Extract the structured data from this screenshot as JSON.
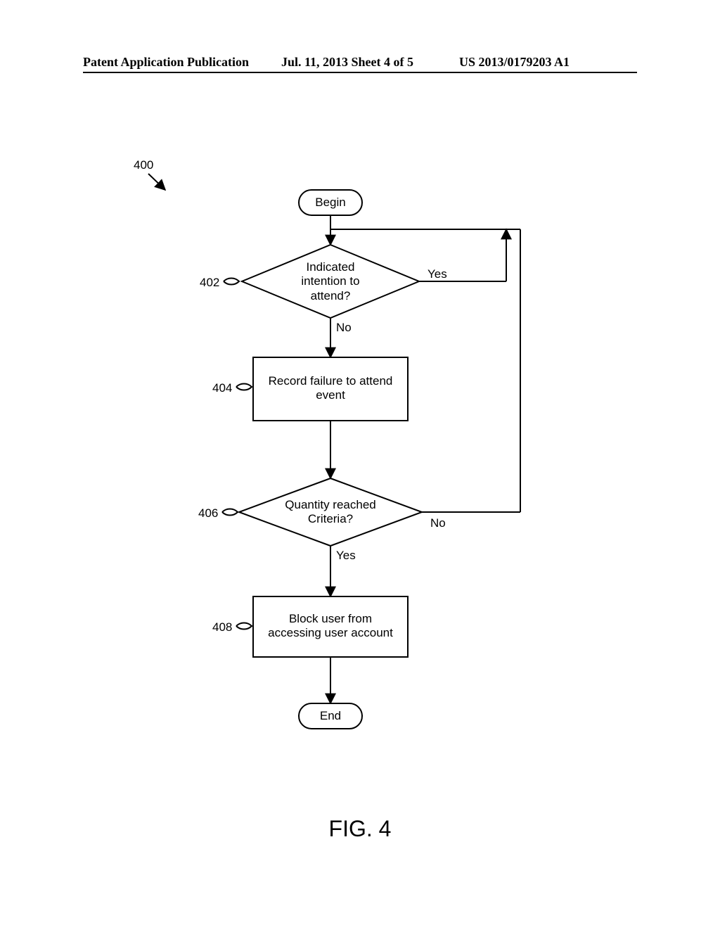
{
  "header": {
    "left": "Patent Application Publication",
    "center": "Jul. 11, 2013  Sheet 4 of 5",
    "right": "US 2013/0179203 A1"
  },
  "figure": {
    "caption": "FIG. 4",
    "flow_ref": "400"
  },
  "nodes": {
    "begin": "Begin",
    "end": "End",
    "d402": "Indicated\nintention to\nattend?",
    "p404": "Record failure to attend\nevent",
    "d406": "Quantity reached\nCriteria?",
    "p408": "Block user from\naccessing user account"
  },
  "refs": {
    "r402": "402",
    "r404": "404",
    "r406": "406",
    "r408": "408"
  },
  "edges": {
    "yes": "Yes",
    "no": "No"
  }
}
